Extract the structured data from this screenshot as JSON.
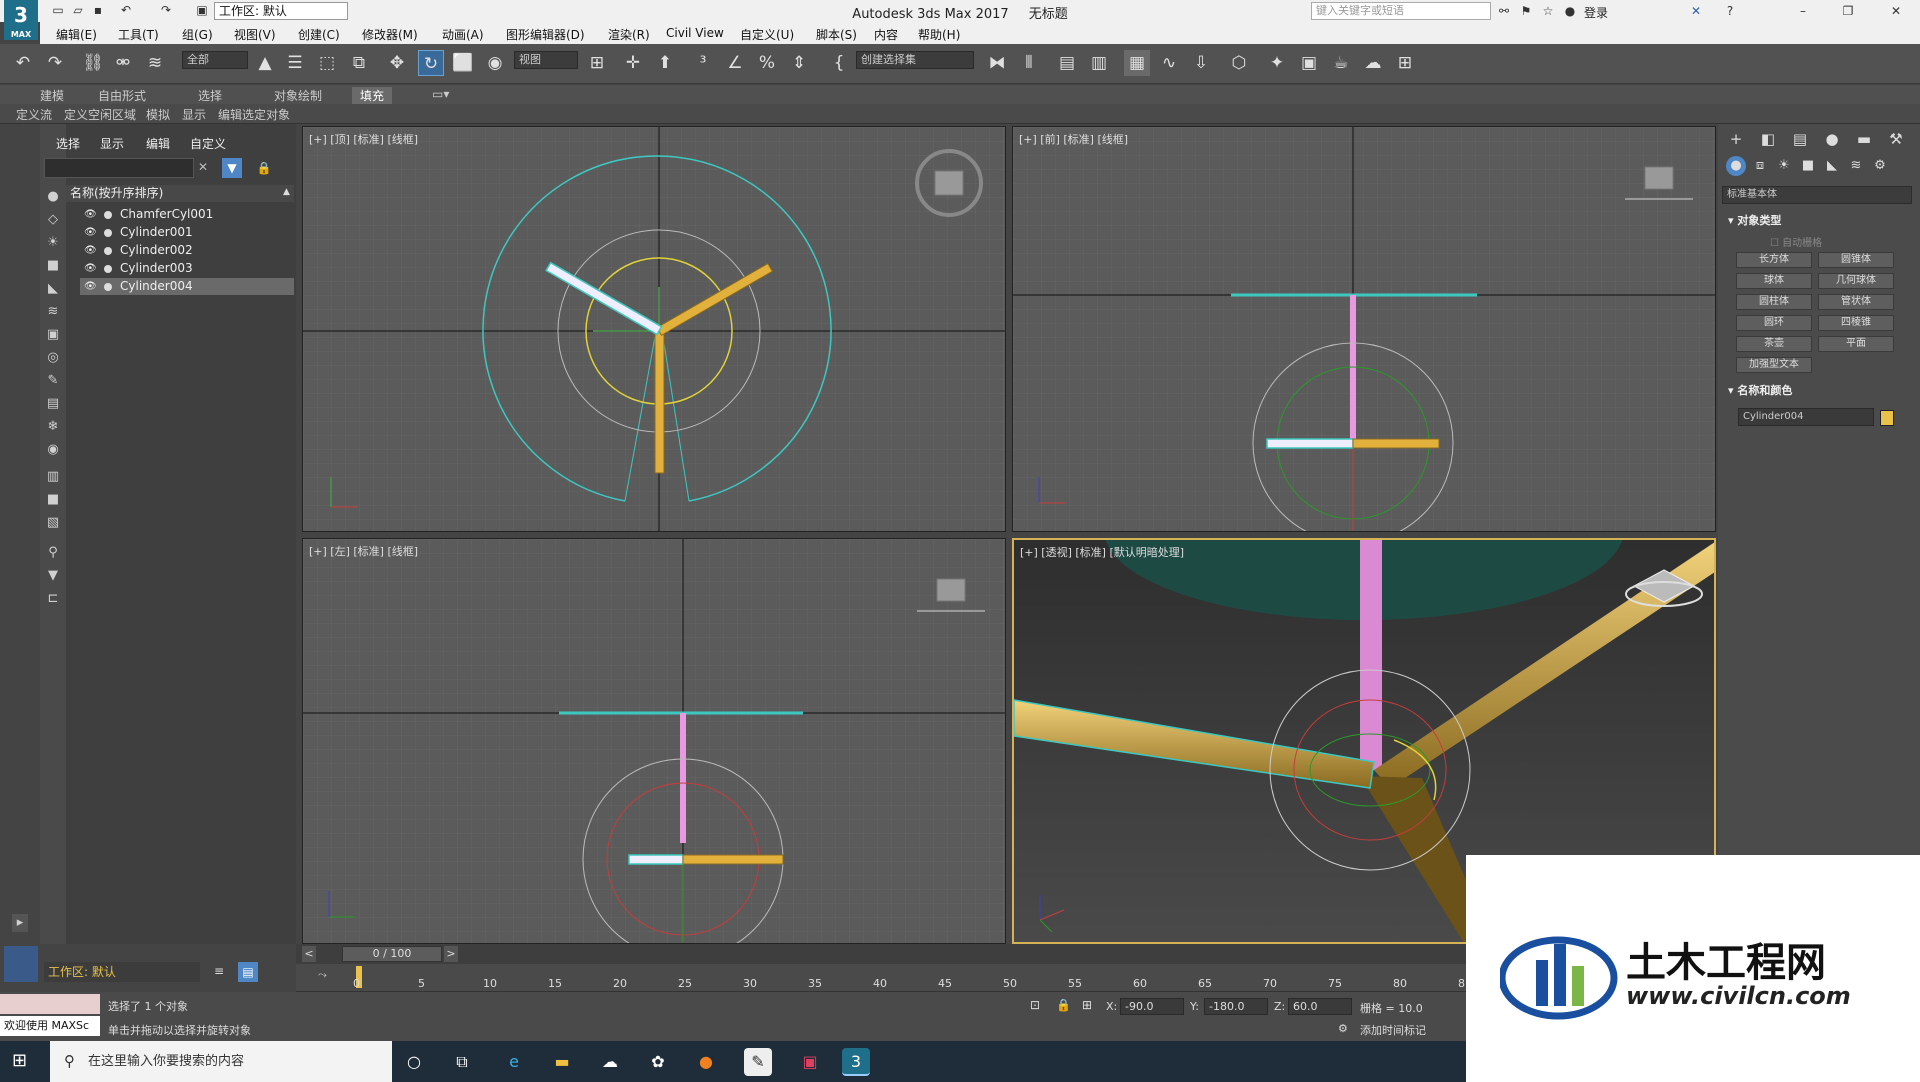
{
  "app": {
    "title": "Autodesk 3ds Max 2017",
    "doc": "无标题",
    "logo_num": "3",
    "logo_sub": "MAX",
    "workspace": "工作区: 默认",
    "search_placeholder": "键入关键字或短语",
    "login": "登录"
  },
  "menu": [
    "编辑(E)",
    "工具(T)",
    "组(G)",
    "视图(V)",
    "创建(C)",
    "修改器(M)",
    "动画(A)",
    "图形编辑器(D)",
    "渲染(R)",
    "Civil View",
    "自定义(U)",
    "脚本(S)",
    "内容",
    "帮助(H)"
  ],
  "toolbar": {
    "filter": "全部",
    "ref_coord": "视图",
    "selset": "创建选择集"
  },
  "ribbon": {
    "tabs": [
      "建模",
      "自由形式",
      "选择",
      "对象绘制",
      "填充"
    ],
    "subtabs": [
      "定义流",
      "定义空闲区域",
      "模拟",
      "显示",
      "编辑选定对象"
    ]
  },
  "scene": {
    "tabs": [
      "选择",
      "显示",
      "编辑",
      "自定义"
    ],
    "header": "名称(按升序排序)",
    "items": [
      "ChamferCyl001",
      "Cylinder001",
      "Cylinder002",
      "Cylinder003",
      "Cylinder004"
    ],
    "workspace": "工作区: 默认"
  },
  "viewports": {
    "top": "[+] [顶] [标准] [线框]",
    "front": "[+] [前] [标准] [线框]",
    "left": "[+] [左] [标准] [线框]",
    "persp": "[+] [透视] [标准] [默认明暗处理]"
  },
  "cmd": {
    "dropdown": "标准基本体",
    "rollout1": "对象类型",
    "autogrid": "自动栅格",
    "buttons": [
      "长方体",
      "圆锥体",
      "球体",
      "几何球体",
      "圆柱体",
      "管状体",
      "圆环",
      "四棱锥",
      "茶壶",
      "平面",
      "加强型文本"
    ],
    "rollout2": "名称和颜色",
    "objname": "Cylinder004",
    "swatch_color": "#e8c24a"
  },
  "timeline": {
    "frame": "0 / 100",
    "ticks": [
      "0",
      "5",
      "10",
      "15",
      "20",
      "25",
      "30",
      "35",
      "40",
      "45",
      "50",
      "55",
      "60",
      "65",
      "70",
      "75",
      "80",
      "8"
    ]
  },
  "status": {
    "maxscript": "欢迎使用 MAXSc",
    "selected": "选择了 1 个对象",
    "hint": "单击并拖动以选择并旋转对象",
    "x_label": "X:",
    "x": "-90.0",
    "y_label": "Y:",
    "y": "-180.0",
    "z_label": "Z:",
    "z": "60.0",
    "grid": "栅格 = 10.0",
    "addtime": "添加时间标记"
  },
  "taskbar": {
    "search": "在这里输入你要搜索的内容"
  },
  "watermark": {
    "text": "土木工程网",
    "url": "www.civilcn.com"
  }
}
